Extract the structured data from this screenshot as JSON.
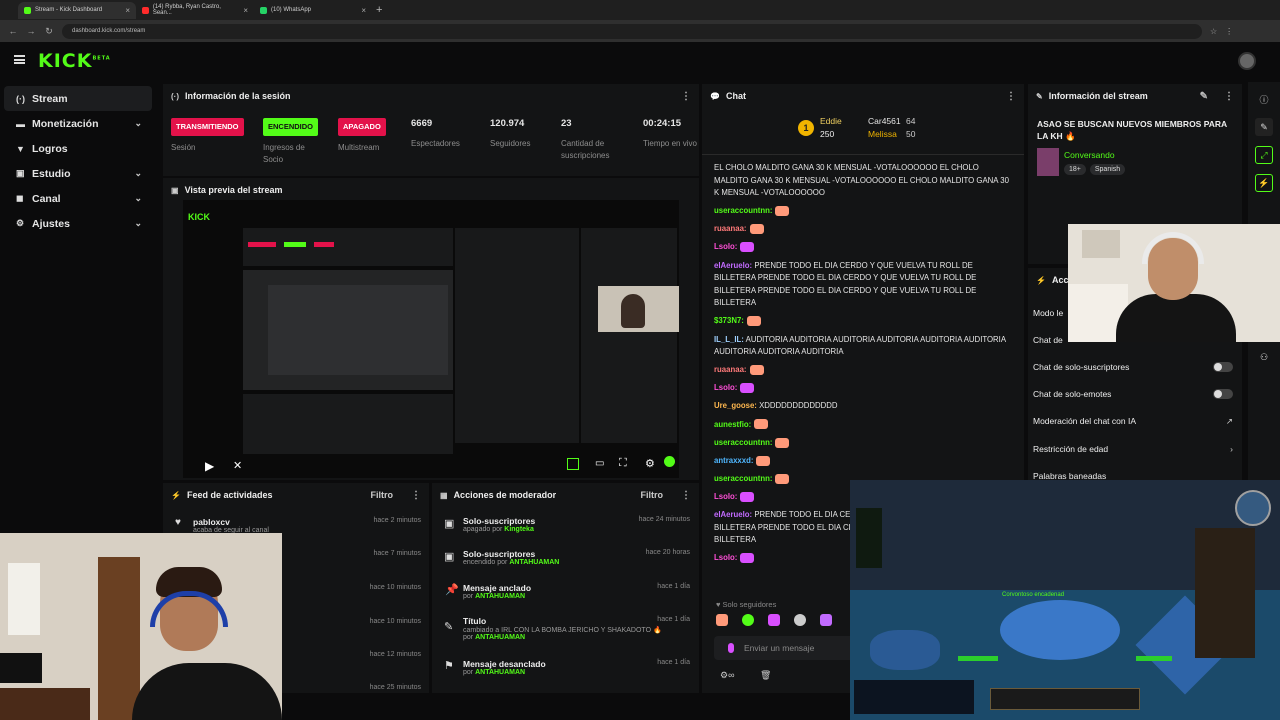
{
  "browser": {
    "tabs": [
      {
        "label": "Stream - Kick Dashboard",
        "color": "#53fc18"
      },
      {
        "label": "(14) Rybba, Ryan Castro, Sean...",
        "color": "#ff2b2b"
      },
      {
        "label": "(10) WhatsApp",
        "color": "#25d366"
      }
    ],
    "url": "dashboard.kick.com/stream"
  },
  "logo": "KICK",
  "logo_sup": "BETA",
  "sidebar": {
    "items": [
      {
        "label": "Stream",
        "icon": "stream-icon",
        "glyph": "(·)"
      },
      {
        "label": "Monetización",
        "icon": "money-icon",
        "glyph": "▬"
      },
      {
        "label": "Logros",
        "icon": "trophy-icon",
        "glyph": "🏆"
      },
      {
        "label": "Estudio",
        "icon": "studio-icon",
        "glyph": "▣"
      },
      {
        "label": "Canal",
        "icon": "channel-icon",
        "glyph": "◼"
      },
      {
        "label": "Ajustes",
        "icon": "gear-icon",
        "glyph": "⚙"
      }
    ]
  },
  "session": {
    "title": "Información de la sesión",
    "stats": [
      {
        "value": "TRANSMITIENDO",
        "label": "Sesión",
        "kind": "red"
      },
      {
        "value": "ENCENDIDO",
        "label": "Ingresos de Socio",
        "kind": "green"
      },
      {
        "value": "APAGADO",
        "label": "Multistream",
        "kind": "red"
      },
      {
        "value": "6669",
        "label": "Espectadores",
        "kind": "num"
      },
      {
        "value": "120.974",
        "label": "Seguidores",
        "kind": "num"
      },
      {
        "value": "23",
        "label": "Cantidad de suscripciones",
        "kind": "num"
      },
      {
        "value": "00:24:15",
        "label": "Tiempo en vivo",
        "kind": "num"
      }
    ]
  },
  "preview": {
    "title": "Vista previa del stream"
  },
  "activity": {
    "title": "Feed de actividades",
    "filter": "Filtro",
    "rows": [
      {
        "name": "pabloxcv",
        "sub": "acaba de seguir al canal",
        "time": "hace 2 minutos"
      },
      {
        "name": "",
        "sub": "",
        "time": "hace 7 minutos"
      },
      {
        "name": "",
        "sub": "",
        "time": "hace 10 minutos"
      },
      {
        "name": "",
        "sub": "",
        "time": "hace 10 minutos"
      },
      {
        "name": "",
        "sub": "",
        "time": "hace 12 minutos"
      },
      {
        "name": "",
        "sub": "",
        "time": "hace 25 minutos"
      }
    ]
  },
  "mod": {
    "title": "Acciones de moderador",
    "filter": "Filtro",
    "rows": [
      {
        "title": "Solo-suscriptores",
        "sub": "apagado por",
        "by": "Kingteka",
        "time": "hace 24 minutos",
        "extra": ""
      },
      {
        "title": "Solo-suscriptores",
        "sub": "encendido por",
        "by": "ANTAHUAMAN",
        "time": "hace 20 horas",
        "extra": ""
      },
      {
        "title": "Mensaje anclado",
        "sub": "por",
        "by": "ANTAHUAMAN",
        "time": "hace 1 día",
        "extra": ""
      },
      {
        "title": "Título",
        "sub": "cambiado a IRL CON LA BOMBA JERICHO Y SHAKADOTO 🔥",
        "by": "ANTAHUAMAN",
        "time": "hace 1 día",
        "extra": "por"
      },
      {
        "title": "Mensaje desanclado",
        "sub": "por",
        "by": "ANTAHUAMAN",
        "time": "hace 1 día",
        "extra": ""
      }
    ]
  },
  "chat": {
    "title": "Chat",
    "leaders": [
      {
        "name": "Eddie",
        "amount": "250"
      },
      {
        "name": "Car4561",
        "amount": "64"
      },
      {
        "name": "Melissa",
        "amount": "50"
      }
    ],
    "messages": [
      {
        "user": "",
        "color": "#e6e6e6",
        "text": "EL CHOLO MALDITO GANA 30 K MENSUAL -VOTALOOOOOO EL CHOLO MALDITO GANA 30 K MENSUAL -VOTALOOOOOO EL CHOLO MALDITO GANA 30 K MENSUAL -VOTALOOOOOO",
        "emotes": []
      },
      {
        "user": "useraccountnn:",
        "color": "#53fc18",
        "text": "",
        "emotes": [
          "#ff9a7a"
        ]
      },
      {
        "user": "ruaanaa:",
        "color": "#ff7a7a",
        "text": "",
        "emotes": [
          "#ff9a7a"
        ]
      },
      {
        "user": "Lsolo:",
        "color": "#ff4fd8",
        "text": "",
        "emotes": [
          "#d94fff"
        ]
      },
      {
        "user": "elAeruelo:",
        "color": "#c26bff",
        "text": "PRENDE TODO EL DIA CERDO Y QUE VUELVA TU ROLL DE BILLETERA PRENDE TODO EL DIA CERDO Y QUE VUELVA TU ROLL DE BILLETERA PRENDE TODO EL DIA CERDO Y QUE VUELVA TU ROLL DE BILLETERA",
        "emotes": []
      },
      {
        "user": "$373N7:",
        "color": "#53fc18",
        "text": "",
        "emotes": [
          "#ff9a7a"
        ]
      },
      {
        "user": "IL_L_IL:",
        "color": "#9fd0ff",
        "text": "AUDITORIA AUDITORIA AUDITORIA AUDITORIA AUDITORIA AUDITORIA AUDITORIA AUDITORIA AUDITORIA",
        "emotes": []
      },
      {
        "user": "ruaanaa:",
        "color": "#ff7a7a",
        "text": "",
        "emotes": [
          "#ff9a7a"
        ]
      },
      {
        "user": "Lsolo:",
        "color": "#ff4fd8",
        "text": "",
        "emotes": [
          "#d94fff"
        ]
      },
      {
        "user": "Ure_goose:",
        "color": "#ffb84f",
        "text": "XDDDDDDDDDDDDD",
        "emotes": []
      },
      {
        "user": "aunestfio:",
        "color": "#53fc18",
        "text": "",
        "emotes": [
          "#ff9a7a"
        ]
      },
      {
        "user": "useraccountnn:",
        "color": "#53fc18",
        "text": "",
        "emotes": [
          "#ff9a7a"
        ]
      },
      {
        "user": "antraxxxd:",
        "color": "#4fb7ff",
        "text": "",
        "emotes": [
          "#ff9a7a"
        ]
      },
      {
        "user": "useraccountnn:",
        "color": "#53fc18",
        "text": "",
        "emotes": [
          "#ff9a7a"
        ]
      },
      {
        "user": "Lsolo:",
        "color": "#ff4fd8",
        "text": "",
        "emotes": [
          "#d94fff"
        ]
      },
      {
        "user": "elAeruelo:",
        "color": "#c26bff",
        "text": "PRENDE TODO EL DIA CERDO Y QUE VUELVA TU ROLL DE BILLETERA PRENDE TODO EL DIA CERDO Y QUE VUELVA TU ROLL DE BILLETERA",
        "emotes": []
      },
      {
        "user": "Lsolo:",
        "color": "#ff4fd8",
        "text": "",
        "emotes": [
          "#d94fff"
        ]
      }
    ],
    "followers_only": "Solo seguidores",
    "input_placeholder": "Enviar un mensaje"
  },
  "stream_info": {
    "title": "Información del stream",
    "stream_title": "ASAO SE BUSCAN NUEVOS MIEMBROS PARA LA KH 🔥",
    "category": "Conversando",
    "tags": [
      "18+",
      "Spanish"
    ]
  },
  "actions": {
    "title": "Acci",
    "rows": [
      {
        "label": "Modo le",
        "kind": "none"
      },
      {
        "label": "Chat de",
        "kind": "none"
      },
      {
        "label": "Chat de solo-suscriptores",
        "kind": "toggle"
      },
      {
        "label": "Chat de solo-emotes",
        "kind": "toggle"
      },
      {
        "label": "Moderación del chat con IA",
        "kind": "link"
      },
      {
        "label": "Restricción de edad",
        "kind": "chevron"
      },
      {
        "label": "Palabras baneadas",
        "kind": "none"
      }
    ]
  },
  "game": {
    "floating_text": "Corvontoso encadenad"
  },
  "colors": {
    "accent": "#53fc18",
    "danger": "#e3124a",
    "panel": "#131415",
    "bg": "#0b0b0c"
  }
}
